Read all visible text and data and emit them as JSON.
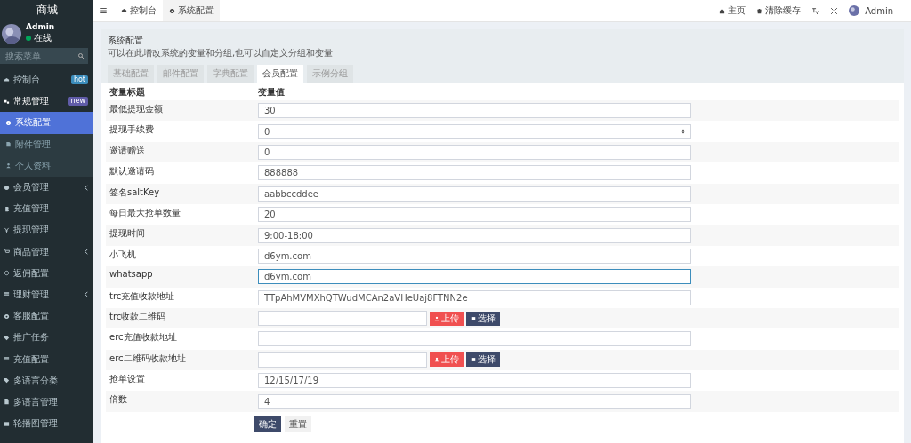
{
  "brand": "商城",
  "user": {
    "name": "Admin",
    "status": "在线",
    "online": true
  },
  "search": {
    "placeholder": "搜索菜单"
  },
  "sidebar": {
    "items": [
      {
        "label": "控制台",
        "badge": {
          "text": "hot",
          "color": "#3c8dbc"
        },
        "selected": false
      },
      {
        "label": "常规管理",
        "badge": {
          "text": "new",
          "color": "#605ca8"
        },
        "selected": false,
        "expanded": true,
        "children": [
          {
            "label": "系统配置",
            "selected": true
          },
          {
            "label": "附件管理",
            "selected": false
          },
          {
            "label": "个人资料",
            "selected": false
          }
        ]
      },
      {
        "label": "会员管理",
        "selected": false,
        "expanded": false
      },
      {
        "label": "充值管理",
        "selected": false
      },
      {
        "label": "提现管理",
        "selected": false
      },
      {
        "label": "商品管理",
        "selected": false,
        "expanded": false
      },
      {
        "label": "返佣配置",
        "selected": false
      },
      {
        "label": "理财管理",
        "selected": false,
        "expanded": false
      },
      {
        "label": "客服配置",
        "selected": false
      },
      {
        "label": "推广任务",
        "selected": false
      },
      {
        "label": "充值配置",
        "selected": false
      },
      {
        "label": "多语言分类",
        "selected": false
      },
      {
        "label": "多语言管理",
        "selected": false
      },
      {
        "label": "轮播图管理",
        "selected": false
      }
    ]
  },
  "top_tabs": [
    {
      "label": "控制台",
      "selected": false
    },
    {
      "label": "系统配置",
      "selected": true
    }
  ],
  "top_right": [
    {
      "label": "主页"
    },
    {
      "label": "清除缓存"
    },
    {
      "kind": "translate"
    },
    {
      "kind": "fullscreen"
    },
    {
      "label": "Admin"
    }
  ],
  "panel": {
    "title": "系统配置",
    "subtitle": "可以在此增改系统的变量和分组,也可以自定义分组和变量",
    "tabs": [
      {
        "label": "基础配置",
        "selected": false
      },
      {
        "label": "邮件配置",
        "selected": false
      },
      {
        "label": "字典配置",
        "selected": false
      },
      {
        "label": "会员配置",
        "selected": true
      },
      {
        "label": "示例分组",
        "selected": false
      }
    ]
  },
  "table": {
    "columns": [
      "变量标题",
      "变量值"
    ],
    "rows": [
      {
        "title": "最低提现金额",
        "kind": "text",
        "value": "30",
        "focused": false
      },
      {
        "title": "提现手续费",
        "kind": "number",
        "value": "0",
        "focused": false
      },
      {
        "title": "邀请赠送",
        "kind": "text",
        "value": "0",
        "focused": false
      },
      {
        "title": "默认邀请码",
        "kind": "text",
        "value": "888888",
        "focused": false
      },
      {
        "title": "签名saltKey",
        "kind": "text",
        "value": "aabbccddee",
        "focused": false
      },
      {
        "title": "每日最大抢单数量",
        "kind": "text",
        "value": "20",
        "focused": false
      },
      {
        "title": "提现时间",
        "kind": "text",
        "value": "9:00-18:00",
        "focused": false
      },
      {
        "title": "小飞机",
        "kind": "text",
        "value": "d6ym.com",
        "focused": false
      },
      {
        "title": "whatsapp",
        "kind": "text",
        "value": "d6ym.com",
        "focused": true
      },
      {
        "title": "trc充值收款地址",
        "kind": "text",
        "value": "TTpAhMVMXhQTWudMCAn2aVHeUaj8FTNN2e",
        "focused": false
      },
      {
        "title": "trc收款二维码",
        "kind": "upload",
        "upload_label": "上传",
        "choose_label": "选择",
        "focused": false
      },
      {
        "title": "erc充值收款地址",
        "kind": "text",
        "focused": false
      },
      {
        "title": "erc二维码收款地址",
        "kind": "upload",
        "upload_label": "上传",
        "choose_label": "选择",
        "focused": false
      },
      {
        "title": "抢单设置",
        "kind": "text",
        "value": "12/15/17/19",
        "focused": false
      },
      {
        "title": "倍数",
        "kind": "text",
        "value": "4",
        "focused": false
      }
    ]
  },
  "actions": [
    {
      "label": "确定",
      "kind": "primary"
    },
    {
      "label": "重置",
      "kind": "default"
    }
  ]
}
